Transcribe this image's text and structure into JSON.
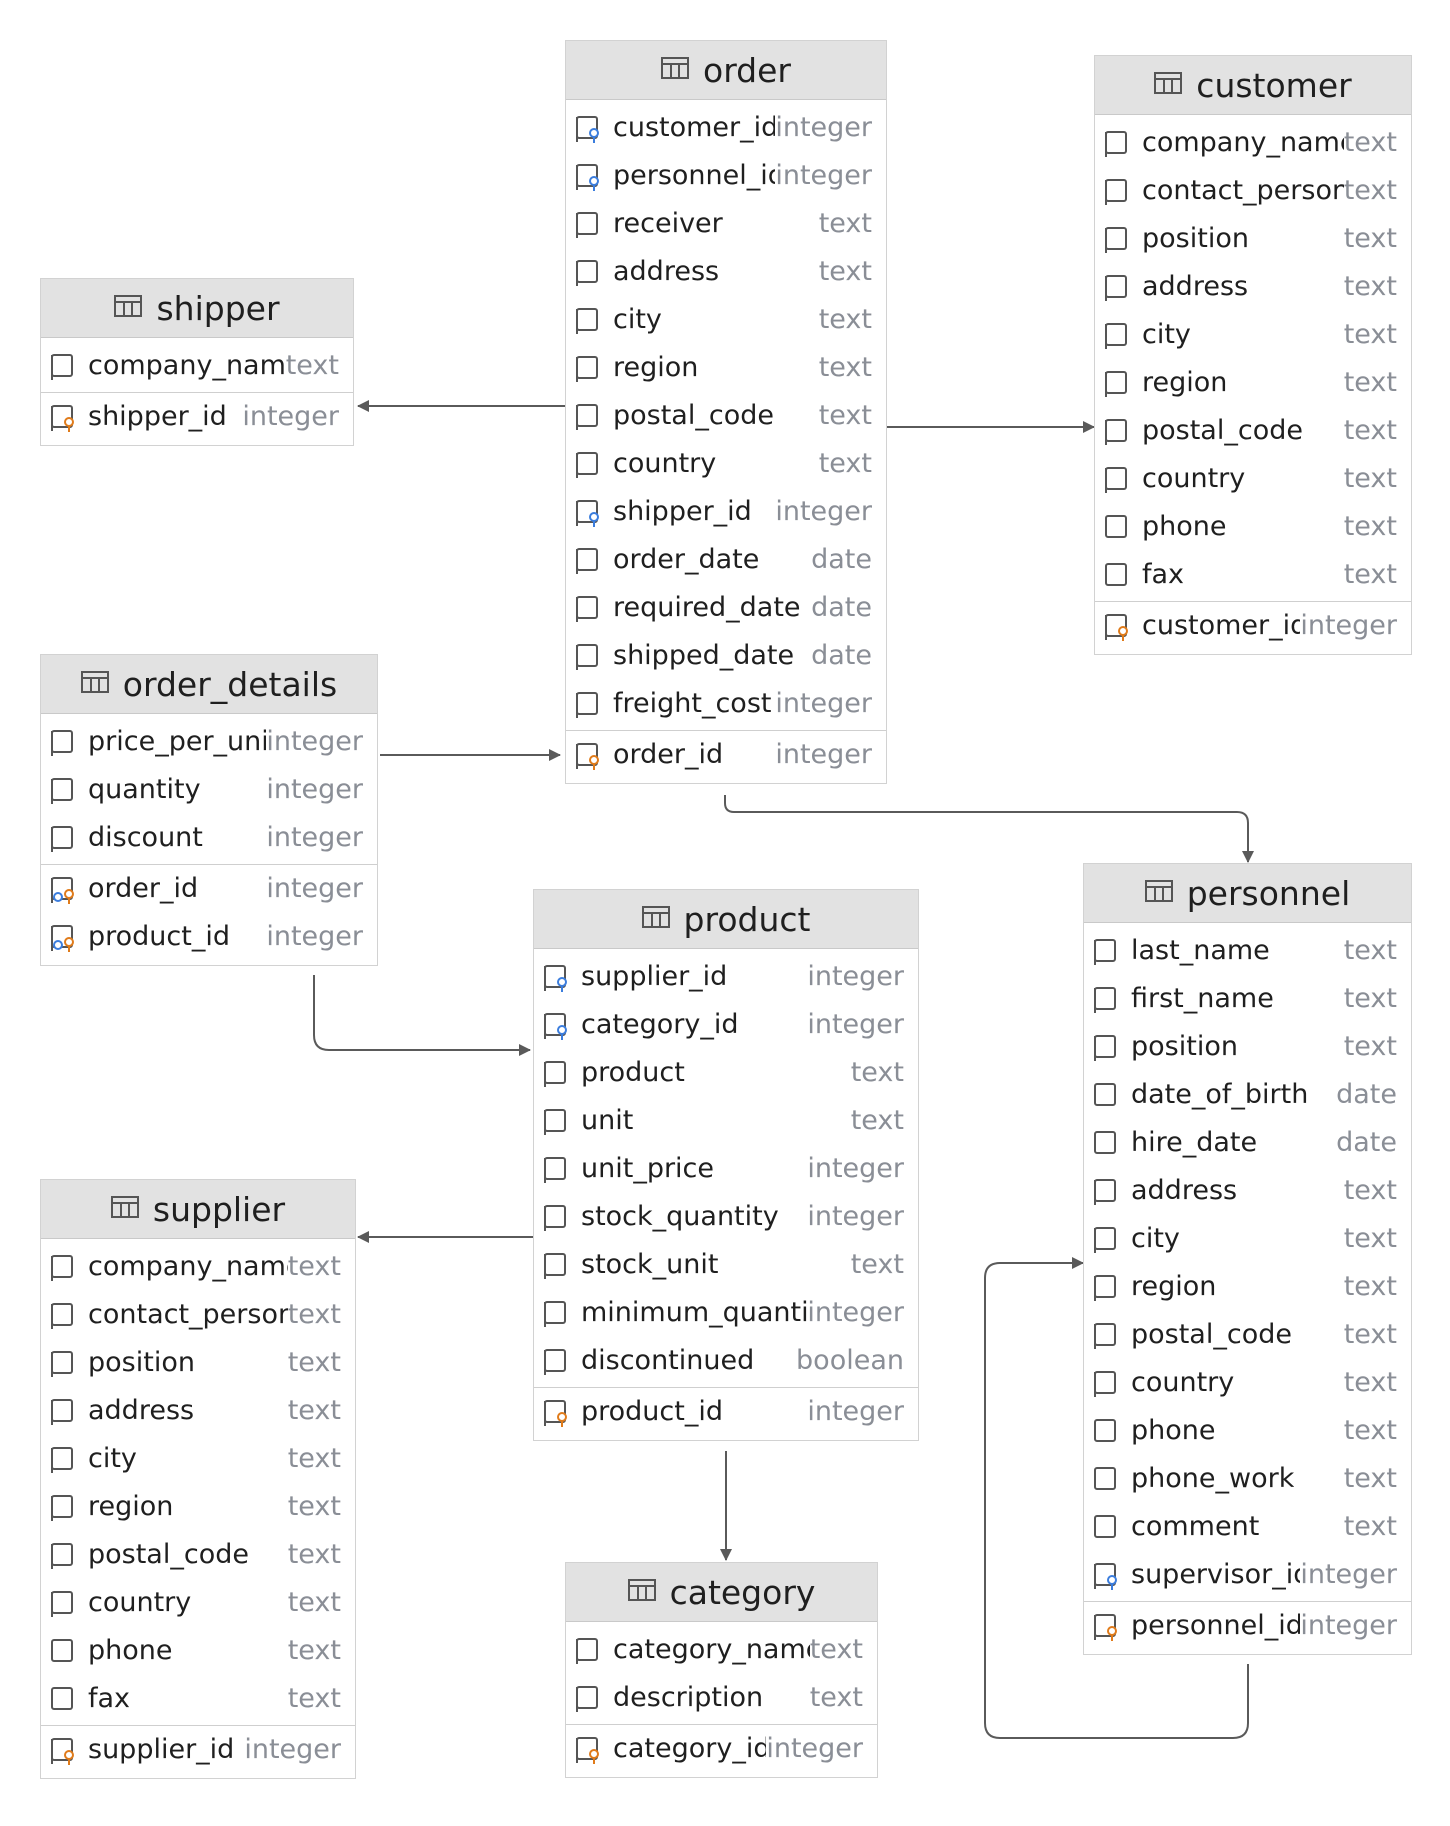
{
  "tables": [
    {
      "id": "order",
      "title": "order",
      "columns": [
        {
          "name": "customer_id",
          "type": "integer",
          "kind": "fk"
        },
        {
          "name": "personnel_id",
          "type": "integer",
          "kind": "fk"
        },
        {
          "name": "receiver",
          "type": "text",
          "kind": "col"
        },
        {
          "name": "address",
          "type": "text",
          "kind": "col"
        },
        {
          "name": "city",
          "type": "text",
          "kind": "col"
        },
        {
          "name": "region",
          "type": "text",
          "kind": "col"
        },
        {
          "name": "postal_code",
          "type": "text",
          "kind": "col"
        },
        {
          "name": "country",
          "type": "text",
          "kind": "col"
        },
        {
          "name": "shipper_id",
          "type": "integer",
          "kind": "fk"
        },
        {
          "name": "order_date",
          "type": "date",
          "kind": "col"
        },
        {
          "name": "required_date",
          "type": "date",
          "kind": "col"
        },
        {
          "name": "shipped_date",
          "type": "date",
          "kind": "col"
        },
        {
          "name": "freight_cost",
          "type": "integer",
          "kind": "col"
        }
      ],
      "keys": [
        {
          "name": "order_id",
          "type": "integer",
          "kind": "pk"
        }
      ]
    },
    {
      "id": "customer",
      "title": "customer",
      "columns": [
        {
          "name": "company_name",
          "type": "text",
          "kind": "col"
        },
        {
          "name": "contact_person",
          "type": "text",
          "kind": "col"
        },
        {
          "name": "position",
          "type": "text",
          "kind": "col"
        },
        {
          "name": "address",
          "type": "text",
          "kind": "col"
        },
        {
          "name": "city",
          "type": "text",
          "kind": "col"
        },
        {
          "name": "region",
          "type": "text",
          "kind": "col"
        },
        {
          "name": "postal_code",
          "type": "text",
          "kind": "col"
        },
        {
          "name": "country",
          "type": "text",
          "kind": "col"
        },
        {
          "name": "phone",
          "type": "text",
          "kind": "plain"
        },
        {
          "name": "fax",
          "type": "text",
          "kind": "plain"
        }
      ],
      "keys": [
        {
          "name": "customer_id",
          "type": "integer",
          "kind": "pk"
        }
      ]
    },
    {
      "id": "shipper",
      "title": "shipper",
      "columns": [
        {
          "name": "company_name",
          "type": "text",
          "kind": "col"
        }
      ],
      "keys": [
        {
          "name": "shipper_id",
          "type": "integer",
          "kind": "pk"
        }
      ]
    },
    {
      "id": "order_details",
      "title": "order_details",
      "columns": [
        {
          "name": "price_per_unit",
          "type": "integer",
          "kind": "col"
        },
        {
          "name": "quantity",
          "type": "integer",
          "kind": "col"
        },
        {
          "name": "discount",
          "type": "integer",
          "kind": "col"
        }
      ],
      "keys": [
        {
          "name": "order_id",
          "type": "integer",
          "kind": "pkfk"
        },
        {
          "name": "product_id",
          "type": "integer",
          "kind": "pkfk"
        }
      ]
    },
    {
      "id": "product",
      "title": "product",
      "columns": [
        {
          "name": "supplier_id",
          "type": "integer",
          "kind": "fk"
        },
        {
          "name": "category_id",
          "type": "integer",
          "kind": "fk"
        },
        {
          "name": "product",
          "type": "text",
          "kind": "col"
        },
        {
          "name": "unit",
          "type": "text",
          "kind": "col"
        },
        {
          "name": "unit_price",
          "type": "integer",
          "kind": "col"
        },
        {
          "name": "stock_quantity",
          "type": "integer",
          "kind": "col"
        },
        {
          "name": "stock_unit",
          "type": "text",
          "kind": "col"
        },
        {
          "name": "minimum_quantity",
          "type": "integer",
          "kind": "col"
        },
        {
          "name": "discontinued",
          "type": "boolean",
          "kind": "col"
        }
      ],
      "keys": [
        {
          "name": "product_id",
          "type": "integer",
          "kind": "pk"
        }
      ]
    },
    {
      "id": "personnel",
      "title": "personnel",
      "columns": [
        {
          "name": "last_name",
          "type": "text",
          "kind": "col"
        },
        {
          "name": "first_name",
          "type": "text",
          "kind": "col"
        },
        {
          "name": "position",
          "type": "text",
          "kind": "col"
        },
        {
          "name": "date_of_birth",
          "type": "date",
          "kind": "plain"
        },
        {
          "name": "hire_date",
          "type": "date",
          "kind": "plain"
        },
        {
          "name": "address",
          "type": "text",
          "kind": "col"
        },
        {
          "name": "city",
          "type": "text",
          "kind": "col"
        },
        {
          "name": "region",
          "type": "text",
          "kind": "col"
        },
        {
          "name": "postal_code",
          "type": "text",
          "kind": "col"
        },
        {
          "name": "country",
          "type": "text",
          "kind": "col"
        },
        {
          "name": "phone",
          "type": "text",
          "kind": "plain"
        },
        {
          "name": "phone_work",
          "type": "text",
          "kind": "plain"
        },
        {
          "name": "comment",
          "type": "text",
          "kind": "plain"
        },
        {
          "name": "supervisor_id",
          "type": "integer",
          "kind": "fk"
        }
      ],
      "keys": [
        {
          "name": "personnel_id",
          "type": "integer",
          "kind": "pk"
        }
      ]
    },
    {
      "id": "supplier",
      "title": "supplier",
      "columns": [
        {
          "name": "company_name",
          "type": "text",
          "kind": "col"
        },
        {
          "name": "contact_person",
          "type": "text",
          "kind": "col"
        },
        {
          "name": "position",
          "type": "text",
          "kind": "col"
        },
        {
          "name": "address",
          "type": "text",
          "kind": "col"
        },
        {
          "name": "city",
          "type": "text",
          "kind": "col"
        },
        {
          "name": "region",
          "type": "text",
          "kind": "col"
        },
        {
          "name": "postal_code",
          "type": "text",
          "kind": "col"
        },
        {
          "name": "country",
          "type": "text",
          "kind": "col"
        },
        {
          "name": "phone",
          "type": "text",
          "kind": "plain"
        },
        {
          "name": "fax",
          "type": "text",
          "kind": "plain"
        }
      ],
      "keys": [
        {
          "name": "supplier_id",
          "type": "integer",
          "kind": "pk"
        }
      ]
    },
    {
      "id": "category",
      "title": "category",
      "columns": [
        {
          "name": "category_name",
          "type": "text",
          "kind": "col"
        },
        {
          "name": "description",
          "type": "text",
          "kind": "col"
        }
      ],
      "keys": [
        {
          "name": "category_id",
          "type": "integer",
          "kind": "pk"
        }
      ]
    }
  ],
  "relationships": [
    {
      "from": "order",
      "to": "shipper"
    },
    {
      "from": "order",
      "to": "customer"
    },
    {
      "from": "order_details",
      "to": "order"
    },
    {
      "from": "order",
      "to": "personnel"
    },
    {
      "from": "order_details",
      "to": "product"
    },
    {
      "from": "product",
      "to": "supplier"
    },
    {
      "from": "product",
      "to": "category"
    },
    {
      "from": "personnel",
      "to": "personnel"
    }
  ],
  "colors": {
    "fk_key": "#3b7ddd",
    "pk_key": "#e07b1a",
    "edge": "#5a5a5a",
    "header_bg": "#e2e2e2"
  }
}
